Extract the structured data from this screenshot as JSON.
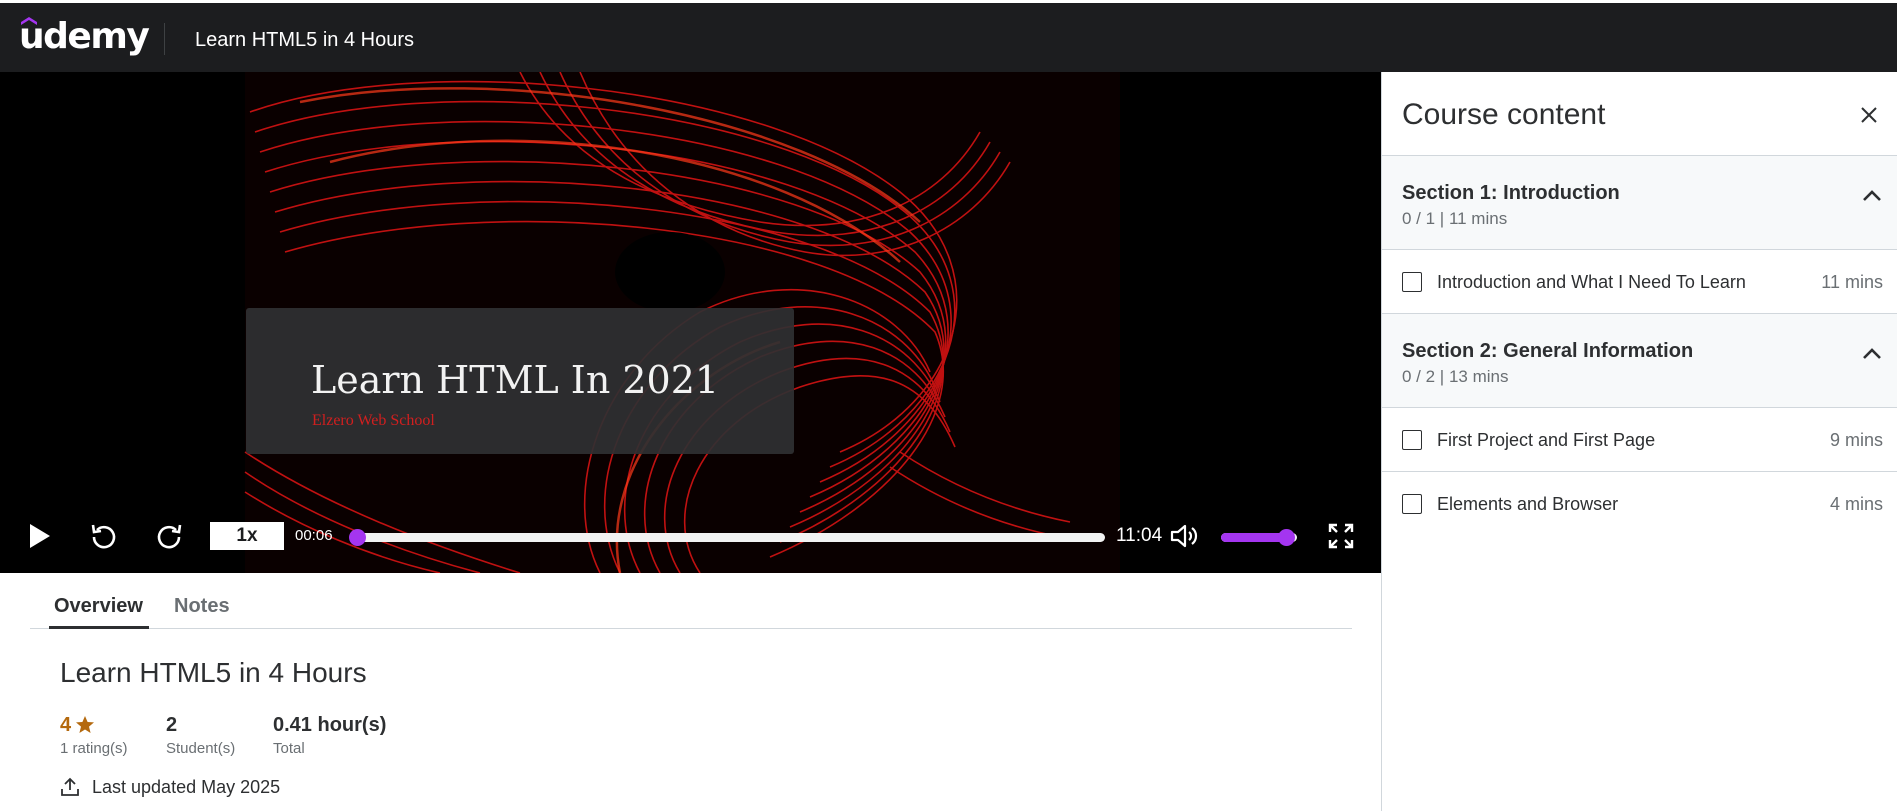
{
  "header": {
    "logo_text": "udemy",
    "course_title": "Learn HTML5 in 4 Hours"
  },
  "video": {
    "title_card_main": "Learn HTML In 2021",
    "title_card_sub": "Elzero Web School",
    "speed": "1x",
    "elapsed": "00:06",
    "total": "11:04",
    "progress_fraction": 0.009,
    "volume_fraction": 0.85
  },
  "tabs": [
    {
      "label": "Overview",
      "active": true
    },
    {
      "label": "Notes",
      "active": false
    }
  ],
  "overview": {
    "title": "Learn HTML5 in 4 Hours",
    "rating_value": "4",
    "rating_label": "1 rating(s)",
    "students_value": "2",
    "students_label": "Student(s)",
    "total_value": "0.41 hour(s)",
    "total_label": "Total",
    "last_updated": "Last updated May 2025"
  },
  "sidebar": {
    "title": "Course content",
    "sections": [
      {
        "title": "Section 1: Introduction",
        "meta": "0 / 1 | 11 mins",
        "lectures": [
          {
            "title": "Introduction and What I Need To Learn",
            "duration": "11 mins"
          }
        ]
      },
      {
        "title": "Section 2: General Information",
        "meta": "0 / 2 | 13 mins",
        "lectures": [
          {
            "title": "First Project and First Page",
            "duration": "9 mins"
          },
          {
            "title": "Elements and Browser",
            "duration": "4 mins"
          }
        ]
      }
    ]
  },
  "colors": {
    "accent": "#a435f0",
    "header_bg": "#1c1d1f",
    "rating": "#b4690e"
  }
}
